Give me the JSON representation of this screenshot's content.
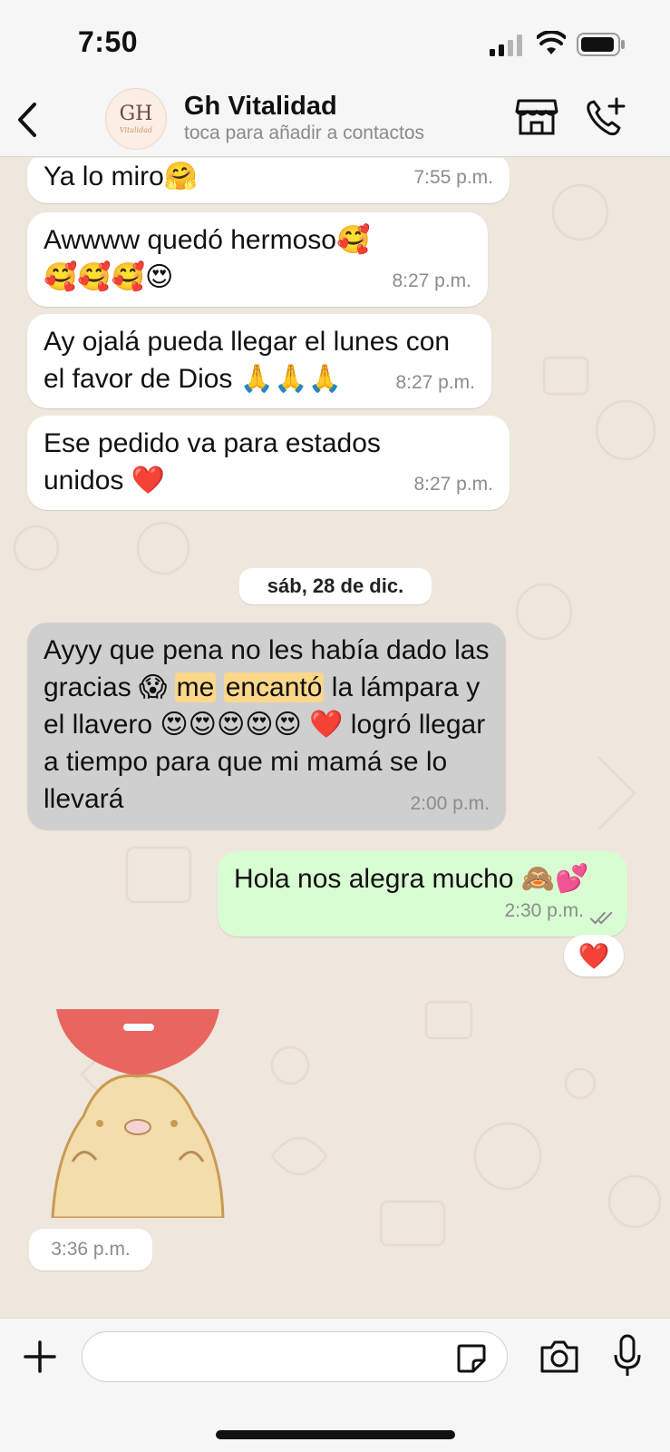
{
  "status_bar": {
    "time": "7:50"
  },
  "header": {
    "contact_name": "Gh Vitalidad",
    "contact_subtitle": "toca para añadir a contactos",
    "avatar_logo": "GH",
    "avatar_sub": "Vitalidad"
  },
  "messages": [
    {
      "text": "Ya lo miro🤗",
      "time": "7:55 p.m."
    },
    {
      "text": "Awwww quedó hermoso🥰🥰🥰🥰😍",
      "time": "8:27 p.m."
    },
    {
      "text": "Ay ojalá pueda llegar el lunes con el favor de Dios 🙏🙏🙏",
      "time": "8:27 p.m."
    },
    {
      "text": "Ese pedido va para estados unidos ❤️",
      "time": "8:27 p.m."
    }
  ],
  "date_separator": "sáb, 28 de dic.",
  "selected_message": {
    "part1": "Ayyy que pena no les había dado las gracias 😱 ",
    "highlight1": "me",
    "highlight2": "encantó",
    "part2": " la lámpara y el llavero 😍😍😍😍😍 ❤️ logró llegar a tiempo para que mi mamá se lo llevará",
    "time": "2:00 p.m."
  },
  "outgoing_message": {
    "text": "Hola nos alegra mucho 🙈💕",
    "time": "2:30 p.m."
  },
  "reaction": "❤️",
  "sticker_time": "3:36 p.m.",
  "input": {
    "placeholder": ""
  },
  "colors": {
    "outgoing_bubble": "#d9fdd3",
    "selected_bubble": "#cfcfcf",
    "highlight": "#fbd78a"
  }
}
